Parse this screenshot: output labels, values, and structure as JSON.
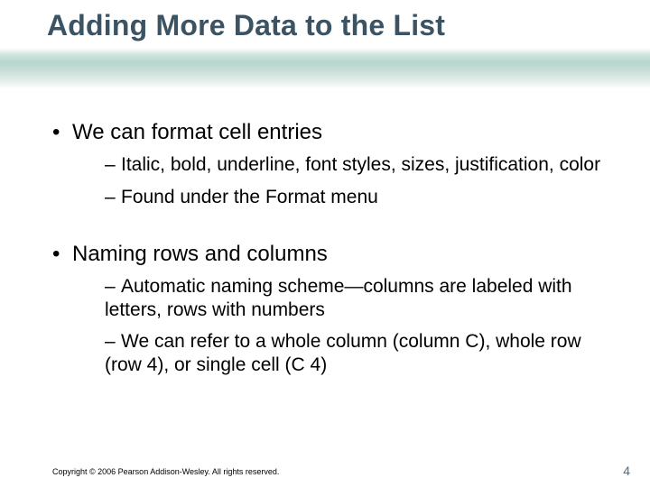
{
  "title": "Adding More Data to the List",
  "bullets": {
    "b1": "We can format cell entries",
    "b1_sub1": "Italic, bold, underline, font styles, sizes, justification, color",
    "b1_sub2": "Found under the Format menu",
    "b2": "Naming rows and columns",
    "b2_sub1": "Automatic naming scheme—columns are labeled with letters, rows with numbers",
    "b2_sub2": "We can refer to a whole column (column C), whole row (row 4), or single cell (C 4)"
  },
  "footer": "Copyright © 2006 Pearson Addison-Wesley. All rights reserved.",
  "page_number": "4"
}
